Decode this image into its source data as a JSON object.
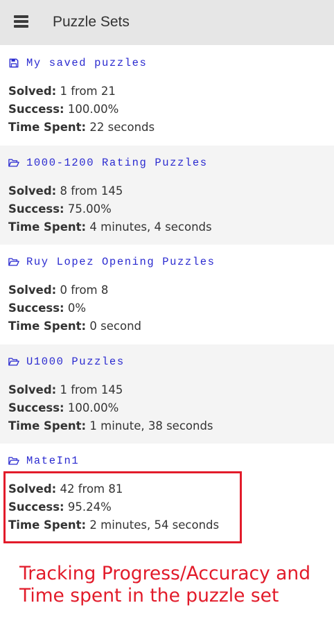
{
  "header": {
    "title": "Puzzle Sets",
    "menu_icon": "hamburger-menu-icon"
  },
  "labels": {
    "solved": "Solved:",
    "success": "Success:",
    "time": "Time Spent:"
  },
  "colors": {
    "accent_link": "#2a2ad0",
    "annotation_red": "#e21b2a",
    "header_bg": "#e6e6e6",
    "alt_row_bg": "#f4f4f4"
  },
  "sets": [
    {
      "icon": "floppy-disk-icon",
      "name": "My saved puzzles",
      "solved": "1 from 21",
      "success": "100.00%",
      "time": "22 seconds"
    },
    {
      "icon": "folder-open-icon",
      "name": "1000-1200 Rating Puzzles",
      "solved": "8 from 145",
      "success": "75.00%",
      "time": "4 minutes, 4 seconds"
    },
    {
      "icon": "folder-open-icon",
      "name": "Ruy Lopez Opening Puzzles",
      "solved": "0 from 8",
      "success": "0%",
      "time": "0 second"
    },
    {
      "icon": "folder-open-icon",
      "name": "U1000 Puzzles",
      "solved": "1 from 145",
      "success": "100.00%",
      "time": "1 minute, 38 seconds"
    },
    {
      "icon": "folder-open-icon",
      "name": "MateIn1",
      "solved": "42 from 81",
      "success": "95.24%",
      "time": "2 minutes, 54 seconds"
    }
  ],
  "annotation": {
    "line1": "Tracking Progress/Accuracy and",
    "line2": "Time spent in the puzzle set"
  }
}
